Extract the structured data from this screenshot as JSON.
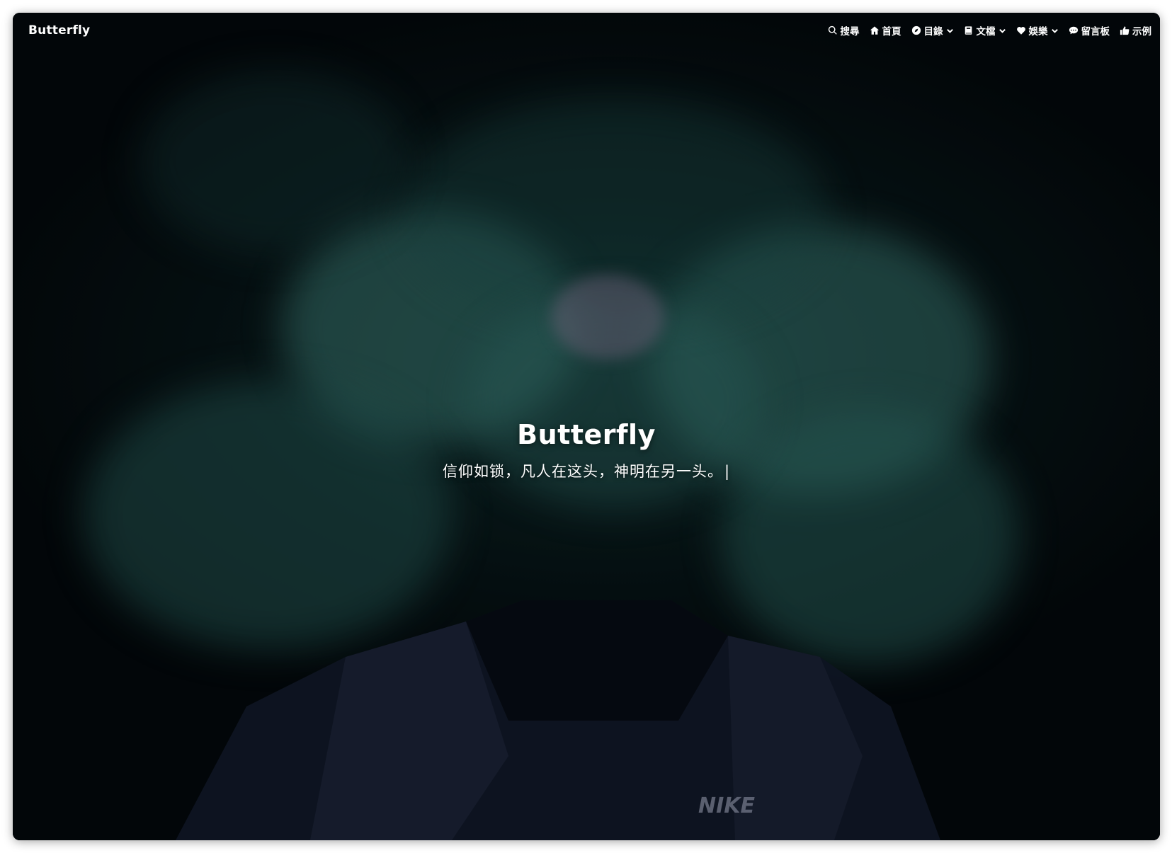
{
  "brand": {
    "name": "Butterfly"
  },
  "nav": {
    "items": [
      {
        "label": "搜尋",
        "icon": "search-icon",
        "has_dropdown": false
      },
      {
        "label": "首頁",
        "icon": "home-icon",
        "has_dropdown": false
      },
      {
        "label": "目錄",
        "icon": "compass-icon",
        "has_dropdown": true
      },
      {
        "label": "文檔",
        "icon": "book-icon",
        "has_dropdown": true
      },
      {
        "label": "娛樂",
        "icon": "heartbeat-icon",
        "has_dropdown": true
      },
      {
        "label": "留言板",
        "icon": "comment-icon",
        "has_dropdown": false
      },
      {
        "label": "示例",
        "icon": "thumbs-up-icon",
        "has_dropdown": false
      }
    ]
  },
  "site": {
    "title": "Butterfly",
    "subtitle": "信仰如锁，凡人在这头，神明在另一头。",
    "cursor": "|"
  },
  "colors": {
    "text": "#ffffff",
    "smoke": "#2f6b66",
    "background": "#04080c"
  }
}
